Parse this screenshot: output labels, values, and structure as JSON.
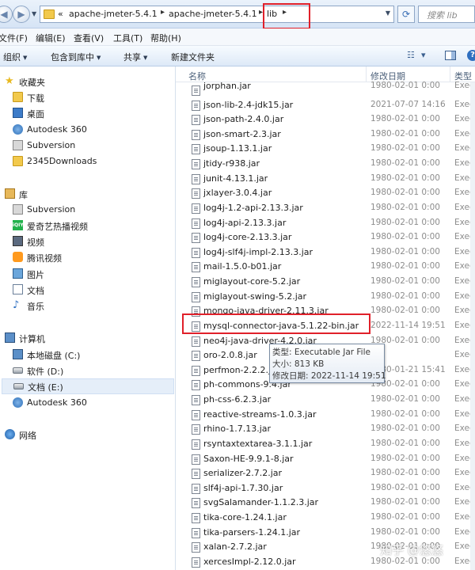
{
  "address_bar": {
    "overflow": "«",
    "crumbs": [
      "apache-jmeter-5.4.1",
      "apache-jmeter-5.4.1",
      "lib"
    ],
    "search_placeholder": "搜索 lib"
  },
  "menu": [
    "文件(F)",
    "编辑(E)",
    "查看(V)",
    "工具(T)",
    "帮助(H)"
  ],
  "toolbar": {
    "organize": "组织",
    "include_library": "包含到库中",
    "share": "共享",
    "new_folder": "新建文件夹"
  },
  "nav": {
    "favorites": {
      "label": "收藏夹",
      "items": [
        "下载",
        "桌面",
        "Autodesk 360",
        "Subversion",
        "2345Downloads"
      ]
    },
    "library": {
      "label": "库",
      "items": [
        "Subversion",
        "爱奇艺热播视频",
        "视频",
        "腾讯视频",
        "图片",
        "文档",
        "音乐"
      ]
    },
    "computer": {
      "label": "计算机",
      "items": [
        "本地磁盘 (C:)",
        "软件 (D:)",
        "文档 (E:)",
        "Autodesk 360"
      ]
    },
    "network": {
      "label": "网络"
    }
  },
  "columns": {
    "name": "名称",
    "date": "修改日期",
    "type": "类型"
  },
  "files": [
    {
      "name": "jorphan.jar",
      "date": "1980-02-01 0:00",
      "type": "Execu"
    },
    {
      "name": "json-lib-2.4-jdk15.jar",
      "date": "2021-07-07 14:16",
      "type": "Execu"
    },
    {
      "name": "json-path-2.4.0.jar",
      "date": "1980-02-01 0:00",
      "type": "Execu"
    },
    {
      "name": "json-smart-2.3.jar",
      "date": "1980-02-01 0:00",
      "type": "Execu"
    },
    {
      "name": "jsoup-1.13.1.jar",
      "date": "1980-02-01 0:00",
      "type": "Execu"
    },
    {
      "name": "jtidy-r938.jar",
      "date": "1980-02-01 0:00",
      "type": "Execu"
    },
    {
      "name": "junit-4.13.1.jar",
      "date": "1980-02-01 0:00",
      "type": "Execu"
    },
    {
      "name": "jxlayer-3.0.4.jar",
      "date": "1980-02-01 0:00",
      "type": "Execu"
    },
    {
      "name": "log4j-1.2-api-2.13.3.jar",
      "date": "1980-02-01 0:00",
      "type": "Execu"
    },
    {
      "name": "log4j-api-2.13.3.jar",
      "date": "1980-02-01 0:00",
      "type": "Execu"
    },
    {
      "name": "log4j-core-2.13.3.jar",
      "date": "1980-02-01 0:00",
      "type": "Execu"
    },
    {
      "name": "log4j-slf4j-impl-2.13.3.jar",
      "date": "1980-02-01 0:00",
      "type": "Execu"
    },
    {
      "name": "mail-1.5.0-b01.jar",
      "date": "1980-02-01 0:00",
      "type": "Execu"
    },
    {
      "name": "miglayout-core-5.2.jar",
      "date": "1980-02-01 0:00",
      "type": "Execu"
    },
    {
      "name": "miglayout-swing-5.2.jar",
      "date": "1980-02-01 0:00",
      "type": "Execu"
    },
    {
      "name": "mongo-java-driver-2.11.3.jar",
      "date": "1980-02-01 0:00",
      "type": "Execu"
    },
    {
      "name": "mysql-connector-java-5.1.22-bin.jar",
      "date": "2022-11-14 19:51",
      "type": "Execu"
    },
    {
      "name": "neo4j-java-driver-4.2.0.jar",
      "date": "1980-02-01 0:00",
      "type": "Execu"
    },
    {
      "name": "oro-2.0.8.jar",
      "date": "",
      "type": "Execu"
    },
    {
      "name": "perfmon-2.2.2.jar",
      "date": "1980-01-21 15:41",
      "type": "Execu"
    },
    {
      "name": "ph-commons-9.4.jar",
      "date": "1980-02-01 0:00",
      "type": "Execu"
    },
    {
      "name": "ph-css-6.2.3.jar",
      "date": "1980-02-01 0:00",
      "type": "Execu"
    },
    {
      "name": "reactive-streams-1.0.3.jar",
      "date": "1980-02-01 0:00",
      "type": "Execu"
    },
    {
      "name": "rhino-1.7.13.jar",
      "date": "1980-02-01 0:00",
      "type": "Execu"
    },
    {
      "name": "rsyntaxtextarea-3.1.1.jar",
      "date": "1980-02-01 0:00",
      "type": "Execu"
    },
    {
      "name": "Saxon-HE-9.9.1-8.jar",
      "date": "1980-02-01 0:00",
      "type": "Execu"
    },
    {
      "name": "serializer-2.7.2.jar",
      "date": "1980-02-01 0:00",
      "type": "Execu"
    },
    {
      "name": "slf4j-api-1.7.30.jar",
      "date": "1980-02-01 0:00",
      "type": "Execu"
    },
    {
      "name": "svgSalamander-1.1.2.3.jar",
      "date": "1980-02-01 0:00",
      "type": "Execu"
    },
    {
      "name": "tika-core-1.24.1.jar",
      "date": "1980-02-01 0:00",
      "type": "Execu"
    },
    {
      "name": "tika-parsers-1.24.1.jar",
      "date": "1980-02-01 0:00",
      "type": "Execu"
    },
    {
      "name": "xalan-2.7.2.jar",
      "date": "1980-02-01 0:00",
      "type": "Execu"
    },
    {
      "name": "xercesImpl-2.12.0.jar",
      "date": "1980-02-01 0:00",
      "type": "Execu"
    }
  ],
  "tooltip": {
    "type_line": "类型: Executable Jar File",
    "size_line": "大小: 813 KB",
    "date_line": "修改日期: 2022-11-14 19:51"
  },
  "watermark": "知乎 @悠悠",
  "colors": {
    "highlight": "#e0202a",
    "selected_bg": "#e5eef9"
  }
}
